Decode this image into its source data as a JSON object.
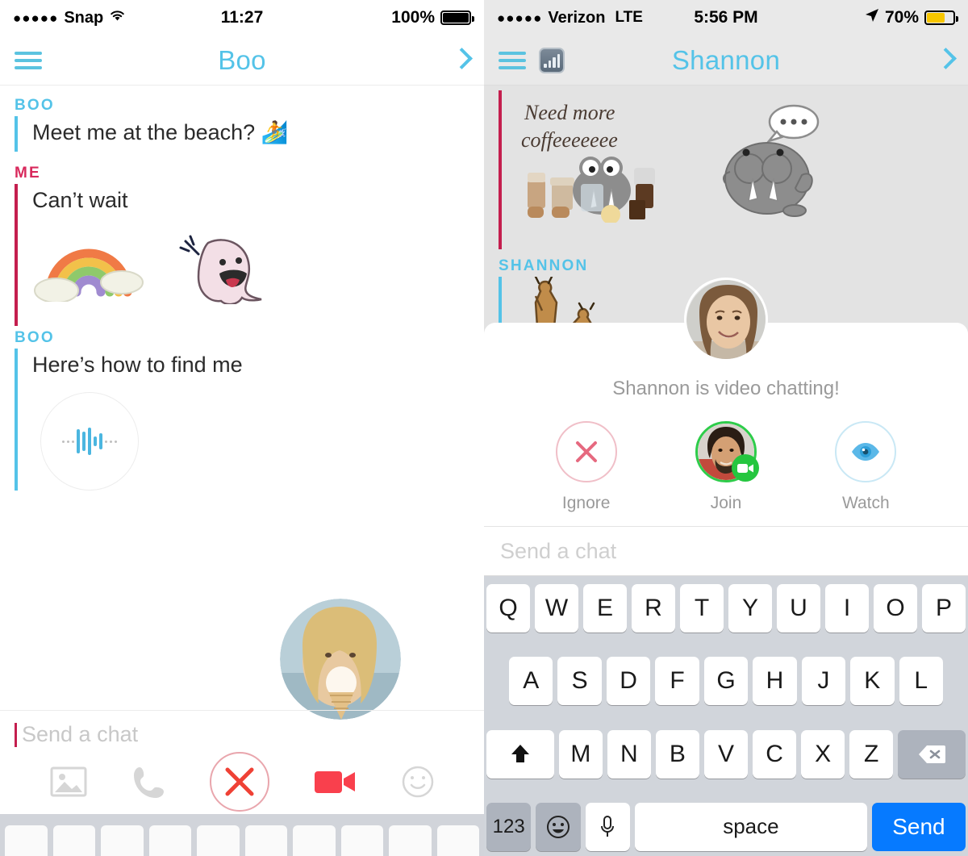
{
  "left": {
    "statusbar": {
      "signal_dots": "●●●●●",
      "carrier": "Snap",
      "wifi_icon": "wifi-icon",
      "time": "11:27",
      "battery_percent": "100%",
      "battery_color": "#000000"
    },
    "nav": {
      "menu_icon": "hamburger-menu-icon",
      "title": "Boo",
      "forward_icon": "chevron-right-icon"
    },
    "messages": [
      {
        "sender": "BOO",
        "sender_type": "them",
        "type": "text",
        "text": "Meet me at the beach? 🏄"
      },
      {
        "sender": "ME",
        "sender_type": "me",
        "type": "text",
        "text": "Can’t wait"
      },
      {
        "sender": "ME",
        "sender_type": "me",
        "type": "stickers",
        "stickers": [
          "rainbow-sticker",
          "ghost-sticker"
        ]
      },
      {
        "sender": "BOO",
        "sender_type": "them",
        "type": "text",
        "text": "Here’s how to find me"
      },
      {
        "sender": "BOO",
        "sender_type": "them",
        "type": "audio",
        "audio_label": "audio-note-waveform"
      }
    ],
    "selfie": {
      "name": "live-video-preview",
      "ring_color": "#e8384f"
    },
    "input": {
      "placeholder": "Send a chat",
      "caret_color": "#c41e4e"
    },
    "toolbar": [
      {
        "name": "photo-gallery-icon",
        "label": "Gallery"
      },
      {
        "name": "phone-call-icon",
        "label": "Call"
      },
      {
        "name": "close-x-button",
        "label": "Close"
      },
      {
        "name": "video-camera-icon",
        "label": "Video"
      },
      {
        "name": "emoji-smiley-icon",
        "label": "Stickers"
      }
    ],
    "colors": {
      "accent_blue": "#54c3e8",
      "accent_red": "#c41e4e",
      "video_red": "#f9404d"
    }
  },
  "right": {
    "statusbar": {
      "signal_dots": "●●●●●",
      "carrier": "Verizon",
      "network": "LTE",
      "time": "5:56 PM",
      "location_icon": "location-arrow-icon",
      "battery_percent": "70%",
      "battery_color": "#f7c600"
    },
    "nav": {
      "menu_icon": "hamburger-menu-icon",
      "signal_icon": "signal-bars-icon",
      "title": "Shannon",
      "forward_icon": "chevron-right-icon"
    },
    "messages": [
      {
        "sender": "",
        "sender_type": "me",
        "type": "stickers",
        "stickers": [
          "walrus-coffee-sticker",
          "walrus-talking-sticker"
        ],
        "caption": "Need more coffeeeeee"
      },
      {
        "sender": "SHANNON",
        "sender_type": "them",
        "type": "stickers",
        "stickers": [
          "giraffe-sticker"
        ]
      }
    ],
    "videochat": {
      "avatar_name": "shannon-avatar",
      "status": "Shannon is video chatting!",
      "actions": [
        {
          "name": "ignore-button",
          "label": "Ignore",
          "icon": "close-x-icon"
        },
        {
          "name": "join-button",
          "label": "Join",
          "icon": "video-camera-badge-icon"
        },
        {
          "name": "watch-button",
          "label": "Watch",
          "icon": "eye-icon"
        }
      ]
    },
    "input": {
      "placeholder": "Send a chat"
    },
    "keyboard": {
      "row1": [
        "Q",
        "W",
        "E",
        "R",
        "T",
        "Y",
        "U",
        "I",
        "O",
        "P"
      ],
      "row2": [
        "A",
        "S",
        "D",
        "F",
        "G",
        "H",
        "J",
        "K",
        "L"
      ],
      "row3": [
        "Z",
        "X",
        "C",
        "V",
        "B",
        "N",
        "M"
      ],
      "shift_icon": "shift-arrow-icon",
      "backspace_icon": "backspace-icon",
      "numbers_label": "123",
      "emoji_icon": "emoji-keyboard-icon",
      "mic_icon": "microphone-icon",
      "space_label": "space",
      "send_label": "Send"
    },
    "colors": {
      "accent_blue": "#54c3e8",
      "accent_red": "#c41e4e",
      "send_blue": "#067aff",
      "join_green": "#25c63f"
    }
  }
}
